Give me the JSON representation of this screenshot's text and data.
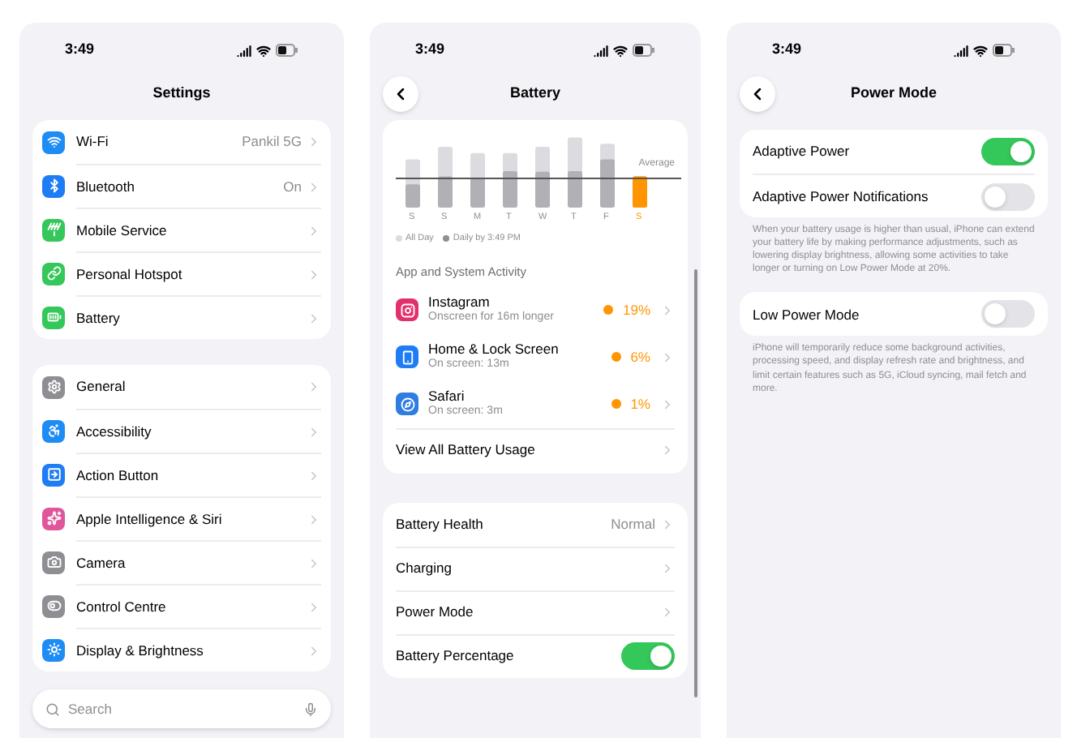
{
  "settings_screen": {
    "time": "3:49",
    "title": "Settings",
    "groups": [
      [
        {
          "label": "Wi-Fi",
          "value": "Pankil 5G",
          "color": "#1e8cf5"
        },
        {
          "label": "Bluetooth",
          "value": "On",
          "color": "#1e7cf5"
        },
        {
          "label": "Mobile Service",
          "color": "#34c759"
        },
        {
          "label": "Personal Hotspot",
          "color": "#34c759"
        },
        {
          "label": "Battery",
          "color": "#34c759"
        }
      ],
      [
        {
          "label": "General",
          "color": "#8e8e93"
        },
        {
          "label": "Accessibility",
          "color": "#1e8cf5"
        },
        {
          "label": "Action Button",
          "color": "#1e7cf5"
        },
        {
          "label": "Apple Intelligence & Siri",
          "color": "#e0569a"
        },
        {
          "label": "Camera",
          "color": "#8e8e93"
        },
        {
          "label": "Control Centre",
          "color": "#8e8e93"
        },
        {
          "label": "Display & Brightness",
          "color": "#1e8cf5"
        }
      ]
    ],
    "search": {
      "placeholder": "Search"
    }
  },
  "battery_screen": {
    "time": "3:49",
    "title": "Battery",
    "chart": {
      "average_label": "Average",
      "days": [
        "S",
        "S",
        "M",
        "T",
        "W",
        "T",
        "F",
        "S"
      ],
      "legend": [
        "All Day",
        "Daily by 3:49 PM"
      ]
    },
    "activity_heading": "App and System Activity",
    "apps": [
      {
        "name": "Instagram",
        "detail": "Onscreen for 16m longer",
        "percent": "19%",
        "color": "#e1306c"
      },
      {
        "name": "Home & Lock Screen",
        "detail": "On screen: 13m",
        "percent": "6%",
        "color": "#1e7cf5"
      },
      {
        "name": "Safari",
        "detail": "On screen: 3m",
        "percent": "1%",
        "color": "#2f7de1"
      }
    ],
    "view_all": "View All Battery Usage",
    "settings": [
      {
        "label": "Battery Health",
        "value": "Normal",
        "kind": "link"
      },
      {
        "label": "Charging",
        "kind": "link"
      },
      {
        "label": "Power Mode",
        "kind": "link"
      },
      {
        "label": "Battery Percentage",
        "kind": "toggle",
        "on": true
      }
    ]
  },
  "power_mode_screen": {
    "time": "3:49",
    "title": "Power Mode",
    "sections": [
      {
        "rows": [
          {
            "label": "Adaptive Power",
            "on": true
          },
          {
            "label": "Adaptive Power Notifications",
            "on": false
          }
        ],
        "footer": "When your battery usage is higher than usual, iPhone can extend your battery life by making performance adjustments, such as lowering display brightness, allowing some activities to take longer or turning on Low Power Mode at 20%."
      },
      {
        "rows": [
          {
            "label": "Low Power Mode",
            "on": false
          }
        ],
        "footer": "iPhone will temporarily reduce some background activities, processing speed, and display refresh rate and brightness, and limit certain features such as 5G, iCloud syncing, mail fetch and more."
      }
    ]
  }
}
